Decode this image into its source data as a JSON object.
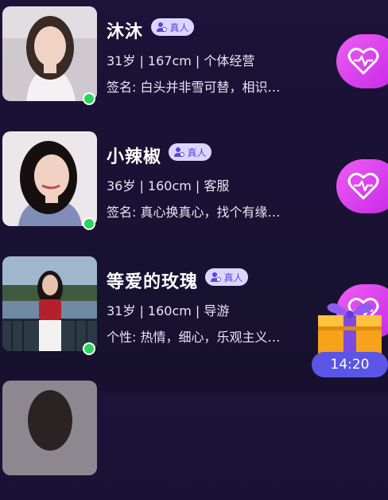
{
  "users": [
    {
      "name": "沐沐",
      "badge": "真人",
      "meta": "31岁 | 167cm | 个体经营",
      "bio": "签名: 白头并非雪可替，相识…",
      "online": true,
      "colors": {
        "bg": "#cfc8cf",
        "hair": "#3a2a26",
        "skin": "#f1d3c4",
        "top": "#f4f1f5"
      }
    },
    {
      "name": "小辣椒",
      "badge": "真人",
      "meta": "36岁 | 160cm | 客服",
      "bio": "签名: 真心换真心，找个有缘…",
      "online": true,
      "colors": {
        "bg": "#ece7ea",
        "hair": "#15100f",
        "skin": "#f0d1c3",
        "top": "#7f8db8"
      }
    },
    {
      "name": "等爱的玫瑰",
      "badge": "真人",
      "meta": "31岁 | 160cm | 导游",
      "bio": "个性: 热情，细心，乐观主义…",
      "online": true,
      "colors": {
        "bg": "#6f8aa4",
        "hair": "#1a1416",
        "skin": "#e8c2ae",
        "top": "#b5202c"
      }
    }
  ],
  "gift": {
    "timer": "14:20"
  },
  "theme": {
    "accent": "#d63fec",
    "online": "#2bd45a",
    "badge_bg": "#dcd6ff",
    "badge_text": "#5b48d8"
  }
}
